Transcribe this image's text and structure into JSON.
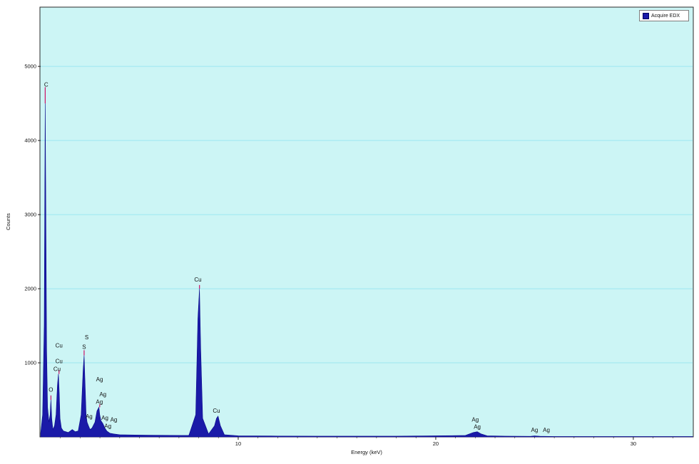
{
  "chart_data": {
    "type": "area",
    "title": "",
    "xlabel": "Energy (keV)",
    "ylabel": "Counts",
    "xlim": [
      0,
      33
    ],
    "ylim": [
      0,
      5800
    ],
    "x_ticks": [
      10,
      20,
      30
    ],
    "y_ticks": [
      1000,
      2000,
      3000,
      4000,
      5000
    ],
    "grid": "horizontal",
    "legend": {
      "placement": "top-right",
      "entries": [
        "Acquire EDX"
      ]
    },
    "colors": {
      "fill": "#1a1aa8",
      "plot_bg": "#ccf5f5",
      "grid": "#9ce6f0",
      "peak_marker": "#cc1166"
    },
    "series": [
      {
        "name": "Acquire EDX",
        "x": [
          0.0,
          0.1,
          0.18,
          0.23,
          0.26,
          0.3,
          0.35,
          0.42,
          0.48,
          0.52,
          0.56,
          0.62,
          0.7,
          0.78,
          0.85,
          0.9,
          0.94,
          0.98,
          1.05,
          1.15,
          1.4,
          1.6,
          1.75,
          1.9,
          2.05,
          2.15,
          2.2,
          2.25,
          2.3,
          2.35,
          2.42,
          2.5,
          2.6,
          2.75,
          2.85,
          2.95,
          2.99,
          3.05,
          3.15,
          3.25,
          3.35,
          3.5,
          3.7,
          4.0,
          5.0,
          6.0,
          7.5,
          7.85,
          7.96,
          8.04,
          8.1,
          8.2,
          8.5,
          8.8,
          8.9,
          8.98,
          9.1,
          9.3,
          10,
          12,
          14,
          16,
          18,
          20,
          21.5,
          21.9,
          22.1,
          22.3,
          22.6,
          23.5,
          24.8,
          25.0,
          25.3,
          26,
          28,
          30,
          33
        ],
        "values": [
          50,
          300,
          1500,
          4500,
          3200,
          1200,
          400,
          200,
          300,
          500,
          250,
          100,
          150,
          300,
          700,
          850,
          600,
          250,
          120,
          80,
          60,
          100,
          70,
          80,
          300,
          900,
          1100,
          700,
          300,
          200,
          150,
          100,
          120,
          200,
          350,
          400,
          300,
          220,
          180,
          120,
          80,
          50,
          40,
          30,
          25,
          22,
          20,
          300,
          1600,
          2000,
          1200,
          250,
          40,
          150,
          250,
          280,
          150,
          30,
          15,
          12,
          10,
          10,
          10,
          15,
          20,
          60,
          70,
          40,
          15,
          10,
          8,
          14,
          8,
          6,
          5,
          5,
          5
        ]
      }
    ],
    "peak_labels": [
      {
        "text": "C",
        "x": 0.28,
        "y": 4700
      },
      {
        "text": "O",
        "x": 0.52,
        "y": 580
      },
      {
        "text": "Cu",
        "x": 0.93,
        "y": 1180
      },
      {
        "text": "Cu",
        "x": 0.93,
        "y": 965
      },
      {
        "text": "Cu",
        "x": 0.83,
        "y": 860
      },
      {
        "text": "S",
        "x": 2.33,
        "y": 1290
      },
      {
        "text": "S",
        "x": 2.2,
        "y": 1160
      },
      {
        "text": "Ag",
        "x": 2.98,
        "y": 720
      },
      {
        "text": "Ag",
        "x": 3.15,
        "y": 520
      },
      {
        "text": "Ag",
        "x": 2.97,
        "y": 420
      },
      {
        "text": "Ag",
        "x": 2.45,
        "y": 220
      },
      {
        "text": "Ag",
        "x": 3.25,
        "y": 200
      },
      {
        "text": "Ag",
        "x": 3.7,
        "y": 180
      },
      {
        "text": "Ag",
        "x": 3.4,
        "y": 90
      },
      {
        "text": "Cu",
        "x": 7.96,
        "y": 2070
      },
      {
        "text": "Cu",
        "x": 8.9,
        "y": 300
      },
      {
        "text": "Ag",
        "x": 22.0,
        "y": 180
      },
      {
        "text": "Ag",
        "x": 22.1,
        "y": 80
      },
      {
        "text": "Ag",
        "x": 25.0,
        "y": 40
      },
      {
        "text": "Ag",
        "x": 25.6,
        "y": 40
      }
    ]
  }
}
